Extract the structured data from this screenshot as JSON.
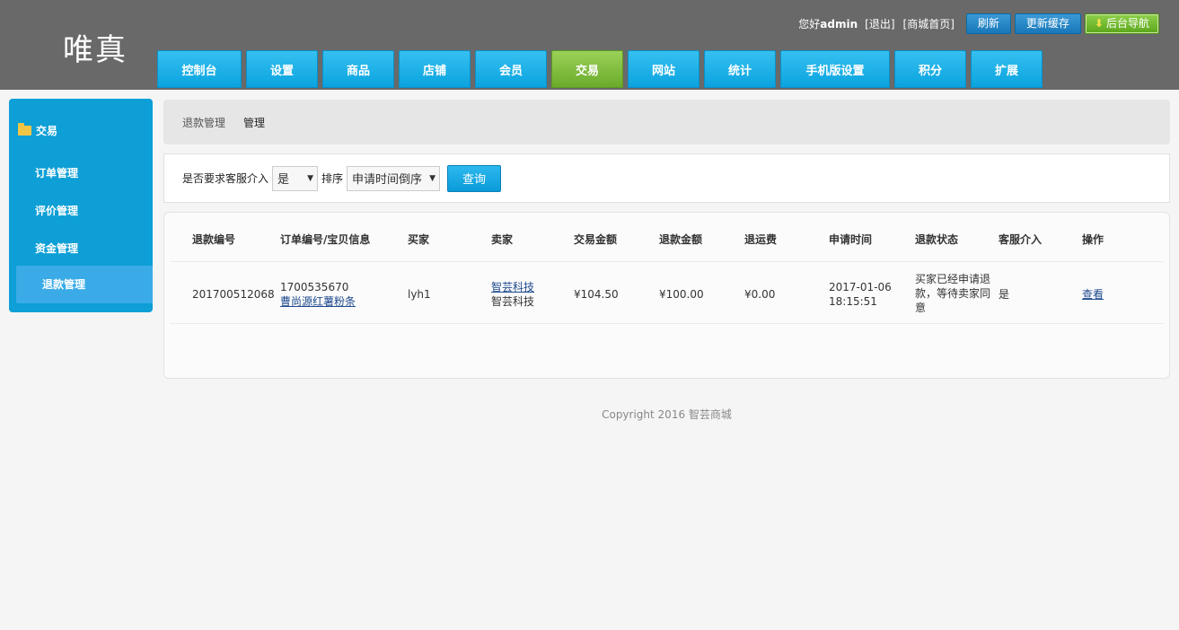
{
  "header": {
    "logo": "唯真",
    "greeting_prefix": "您好",
    "username": "admin",
    "logout": "[退出]",
    "home": "[商城首页]",
    "refresh": "刷新",
    "update_cache": "更新缓存",
    "admin_nav": "后台导航"
  },
  "nav": [
    {
      "label": "控制台"
    },
    {
      "label": "设置"
    },
    {
      "label": "商品"
    },
    {
      "label": "店铺"
    },
    {
      "label": "会员"
    },
    {
      "label": "交易",
      "active": true
    },
    {
      "label": "网站"
    },
    {
      "label": "统计"
    },
    {
      "label": "手机版设置"
    },
    {
      "label": "积分"
    },
    {
      "label": "扩展"
    }
  ],
  "sidebar": {
    "group": "交易",
    "items": [
      {
        "label": "订单管理"
      },
      {
        "label": "评价管理"
      },
      {
        "label": "资金管理"
      },
      {
        "label": "退款管理",
        "active": true
      }
    ]
  },
  "breadcrumb": {
    "section": "退款管理",
    "page": "管理"
  },
  "filter": {
    "service_label": "是否要求客服介入",
    "service_value": "是",
    "sort_label": "排序",
    "sort_value": "申请时间倒序",
    "query_button": "查询"
  },
  "table": {
    "headers": [
      "退款编号",
      "订单编号/宝贝信息",
      "买家",
      "卖家",
      "交易金额",
      "退款金额",
      "退运费",
      "申请时间",
      "退款状态",
      "客服介入",
      "操作"
    ],
    "rows": [
      {
        "refund_no": "201700512068",
        "order_no": "1700535670",
        "item_name": "曹尚源红薯粉条",
        "buyer": "lyh1",
        "seller_link": "智芸科技",
        "seller_name": "智芸科技",
        "trade_amount": "¥104.50",
        "refund_amount": "¥100.00",
        "shipping_refund": "¥0.00",
        "apply_date": "2017-01-06",
        "apply_time": "18:15:51",
        "status": "买家已经申请退款，等待卖家同意",
        "service": "是",
        "action": "查看"
      }
    ]
  },
  "footer": {
    "copyright": "Copyright 2016 智芸商城"
  }
}
